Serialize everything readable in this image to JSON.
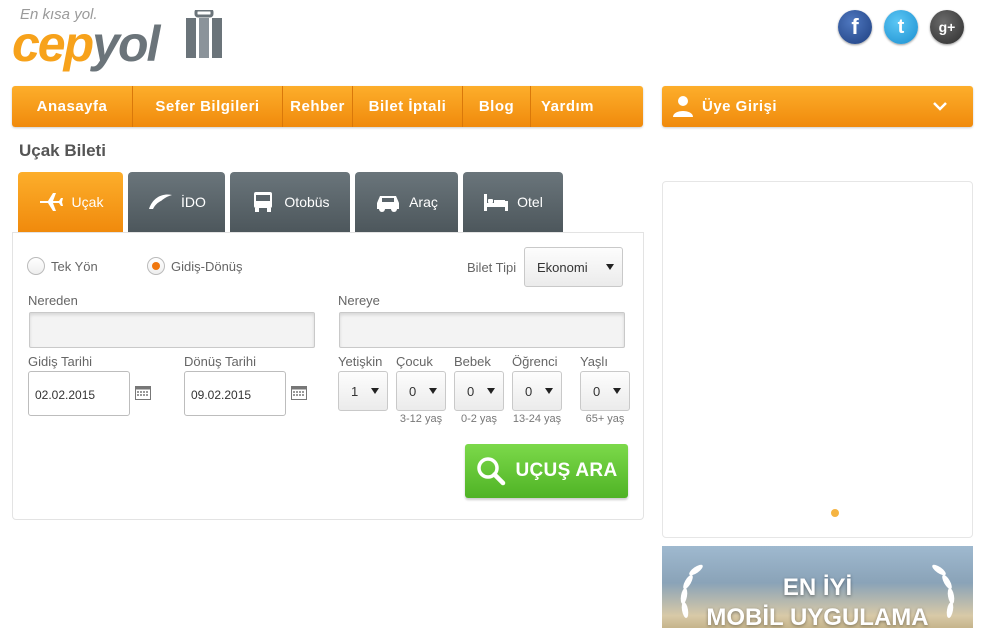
{
  "brand": {
    "tagline": "En kısa yol.",
    "name_part1": "cep",
    "name_part2": "yol"
  },
  "social": {
    "facebook": "f",
    "twitter": "t",
    "googleplus": "g+"
  },
  "nav": [
    "Anasayfa",
    "Sefer Bilgileri",
    "Rehber",
    "Bilet İptali",
    "Blog",
    "Yardım"
  ],
  "login": {
    "label": "Üye Girişi"
  },
  "page_title": "Uçak Bileti",
  "tabs": [
    {
      "label": "Uçak",
      "icon": "plane-icon",
      "active": true
    },
    {
      "label": "İDO",
      "icon": "ferry-icon"
    },
    {
      "label": "Otobüs",
      "icon": "bus-icon"
    },
    {
      "label": "Araç",
      "icon": "car-icon"
    },
    {
      "label": "Otel",
      "icon": "bed-icon"
    }
  ],
  "form": {
    "trip_one_way": "Tek Yön",
    "trip_round": "Gidiş-Dönüş",
    "ticket_type_label": "Bilet Tipi",
    "ticket_type_value": "Ekonomi",
    "from_label": "Nereden",
    "to_label": "Nereye",
    "depart_label": "Gidiş Tarihi",
    "depart_value": "02.02.2015",
    "return_label": "Dönüş Tarihi",
    "return_value": "09.02.2015",
    "passengers": [
      {
        "label": "Yetişkin",
        "value": "1",
        "hint": ""
      },
      {
        "label": "Çocuk",
        "value": "0",
        "hint": "3-12 yaş"
      },
      {
        "label": "Bebek",
        "value": "0",
        "hint": "0-2 yaş"
      },
      {
        "label": "Öğrenci",
        "value": "0",
        "hint": "13-24 yaş"
      },
      {
        "label": "Yaşlı",
        "value": "0",
        "hint": "65+ yaş"
      }
    ],
    "search_label": "UÇUŞ ARA"
  },
  "promo": {
    "line1": "EN İYİ",
    "line2": "MOBİL UYGULAMA"
  },
  "colors": {
    "accent": "#f39a17",
    "tab_dark": "#5a646a",
    "search_green": "#5fc233"
  }
}
